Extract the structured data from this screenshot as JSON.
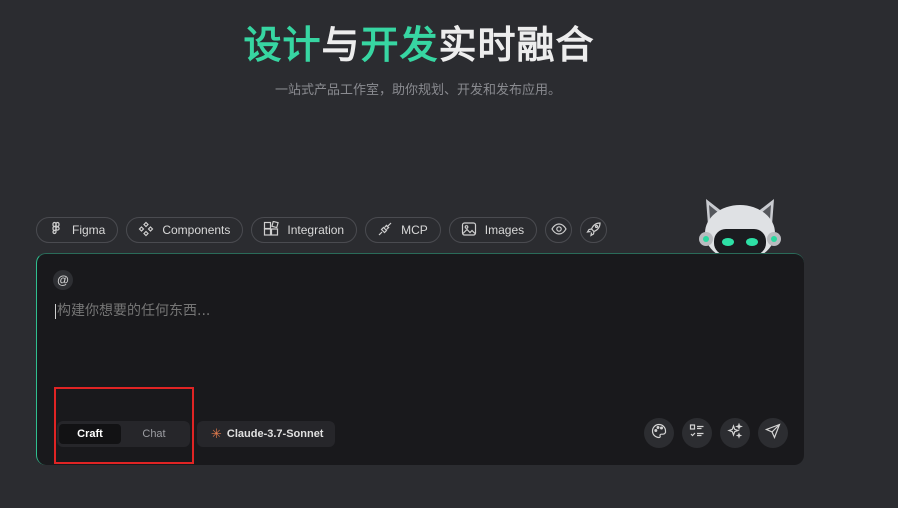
{
  "hero": {
    "title_part1": "设计",
    "title_part2": "与",
    "title_part3": "开发",
    "title_part4": "实时融合",
    "subtitle": "一站式产品工作室，助你规划、开发和发布应用。"
  },
  "chips": [
    {
      "label": "Figma",
      "icon": "figma-icon"
    },
    {
      "label": "Components",
      "icon": "components-icon"
    },
    {
      "label": "Integration",
      "icon": "integration-icon"
    },
    {
      "label": "MCP",
      "icon": "plug-icon"
    },
    {
      "label": "Images",
      "icon": "image-icon"
    },
    {
      "icon": "eye-icon"
    },
    {
      "icon": "rocket-icon"
    }
  ],
  "composer": {
    "mention_symbol": "@",
    "placeholder": "构建你想要的任何东西...",
    "modes": {
      "active": "Craft",
      "inactive": "Chat"
    },
    "model": "Claude-3.7-Sonnet",
    "tools": [
      "palette-icon",
      "checklist-icon",
      "sparkles-icon",
      "send-icon"
    ]
  },
  "colors": {
    "accent": "#37d6a2",
    "background": "#2b2c30",
    "panel": "#19191c",
    "highlight": "#e02424"
  }
}
